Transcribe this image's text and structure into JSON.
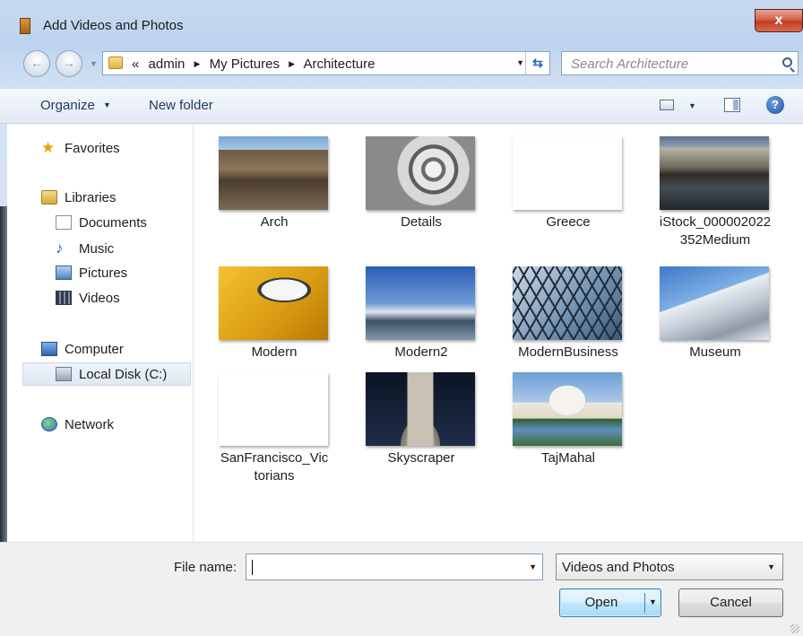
{
  "window": {
    "title": "Add Videos and Photos",
    "close_glyph": "x"
  },
  "address": {
    "overflow_glyph": "«",
    "crumbs": [
      "admin",
      "My Pictures",
      "Architecture"
    ],
    "search_placeholder": "Search Architecture"
  },
  "toolbar": {
    "organize": "Organize",
    "new_folder": "New folder",
    "help_glyph": "?"
  },
  "nav": {
    "favorites": "Favorites",
    "libraries": "Libraries",
    "documents": "Documents",
    "music": "Music",
    "pictures": "Pictures",
    "videos": "Videos",
    "computer": "Computer",
    "local_disk": "Local Disk (C:)",
    "network": "Network"
  },
  "files": [
    {
      "name": "Arch"
    },
    {
      "name": "Details"
    },
    {
      "name": "Greece"
    },
    {
      "name": "iStock_000002022\n352Medium"
    },
    {
      "name": "Modern"
    },
    {
      "name": "Modern2"
    },
    {
      "name": "ModernBusiness"
    },
    {
      "name": "Museum"
    },
    {
      "name": "SanFrancisco_Vic\ntorians"
    },
    {
      "name": "Skyscraper"
    },
    {
      "name": "TajMahal"
    }
  ],
  "footer": {
    "file_name_label": "File name:",
    "file_name_value": "",
    "filter_value": "Videos and Photos",
    "open_label": "Open",
    "cancel_label": "Cancel"
  },
  "colors": {
    "accent": "#1e395b",
    "selection": "#dfe8f4",
    "close": "#c23b22"
  }
}
